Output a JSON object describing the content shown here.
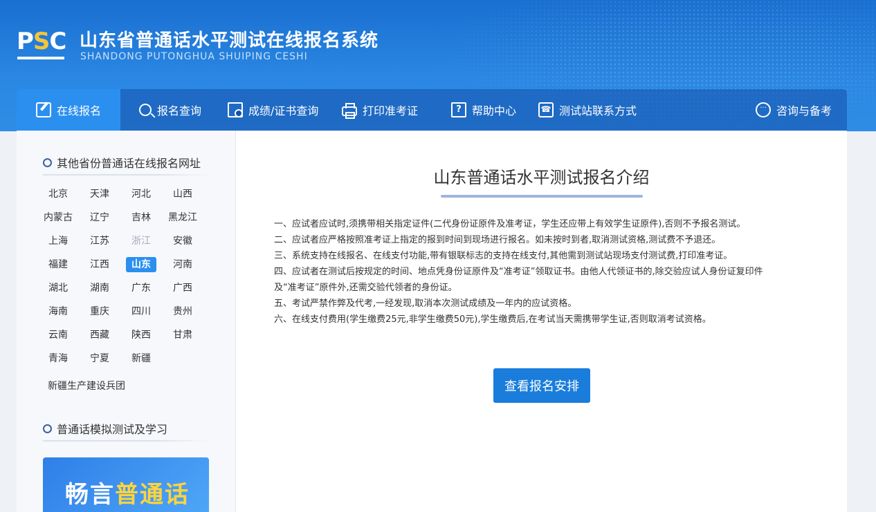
{
  "header": {
    "logo": {
      "p": "P",
      "s": "S",
      "c": "C"
    },
    "title": "山东省普通话水平测试在线报名系统",
    "subtitle": "SHANDONG PUTONGHUA SHUIPING CESHI"
  },
  "nav": {
    "items": [
      {
        "label": "在线报名",
        "icon": "edit-icon"
      },
      {
        "label": "报名查询",
        "icon": "search-icon"
      },
      {
        "label": "成绩/证书查询",
        "icon": "document-search-icon"
      },
      {
        "label": "打印准考证",
        "icon": "printer-icon"
      },
      {
        "label": "帮助中心",
        "icon": "help-icon"
      },
      {
        "label": "测试站联系方式",
        "icon": "phone-icon"
      },
      {
        "label": "咨询与备考",
        "icon": "chat-icon"
      }
    ],
    "help_glyph": "?",
    "phone_glyph": "☎",
    "chat_glyph": "···"
  },
  "sidebar": {
    "provinces_heading": "其他省份普通话在线报名网址",
    "provinces": [
      "北京",
      "天津",
      "河北",
      "山西",
      "内蒙古",
      "辽宁",
      "吉林",
      "黑龙江",
      "上海",
      "江苏",
      "浙江",
      "安徽",
      "福建",
      "江西",
      "山东",
      "河南",
      "湖北",
      "湖南",
      "广东",
      "广西",
      "海南",
      "重庆",
      "四川",
      "贵州",
      "云南",
      "西藏",
      "陕西",
      "甘肃",
      "青海",
      "宁夏",
      "新疆"
    ],
    "active_province": "山东",
    "disabled_province": "浙江",
    "bingtuan": "新疆生产建设兵团",
    "study_heading": "普通话模拟测试及学习",
    "promo": {
      "part1": "畅言",
      "part2": "普通话"
    }
  },
  "main": {
    "title": "山东普通话水平测试报名介绍",
    "rules": [
      "一、应试者应试时,须携带相关指定证件(二代身份证原件及准考证，学生还应带上有效学生证原件),否则不予报名测试。",
      "二、应试者应严格按照准考证上指定的报到时间到现场进行报名。如未按时到者,取消测试资格,测试费不予退还。",
      "三、系统支持在线报名、在线支付功能,带有银联标志的支持在线支付,其他需到测试站现场支付测试费,打印准考证。",
      "四、应试者在测试后按规定的时间、地点凭身份证原件及“准考证”领取证书。由他人代领证书的,除交验应试人身份证复印件",
      "及“准考证”原件外,还需交验代领者的身份证。",
      "五、考试严禁作弊及代考,一经发现,取消本次测试成绩及一年内的应试资格。",
      "六、在线支付费用(学生缴费25元,非学生缴费50元),学生缴费后,在考试当天需携带学生证,否则取消考试资格。"
    ],
    "cta_label": "查看报名安排"
  },
  "colors": {
    "header_blue": "#2a87e3",
    "accent": "#2b8ff0",
    "button": "#1a7ddb"
  }
}
